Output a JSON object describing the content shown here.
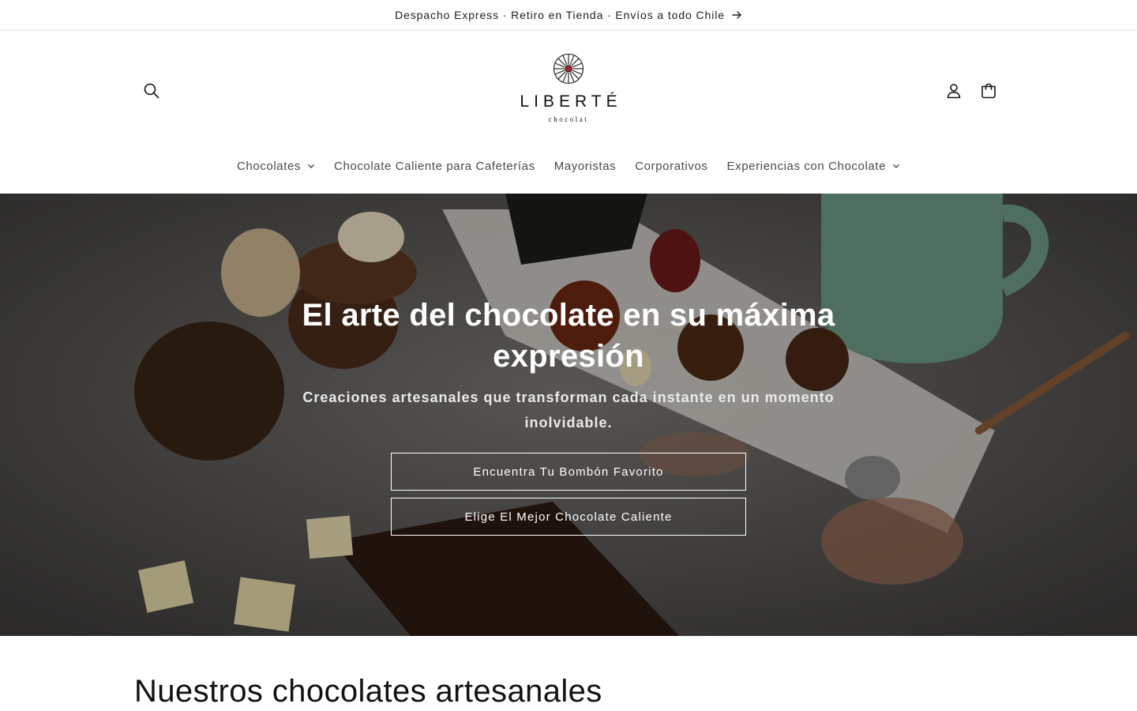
{
  "announcement": {
    "text": "Despacho Express · Retiro en Tienda · Envíos a todo Chile",
    "icon": "arrow-right-icon"
  },
  "header": {
    "search_icon": "search-icon",
    "account_icon": "account-icon",
    "cart_icon": "cart-icon",
    "logo": {
      "wordmark": "LIBERTÉ",
      "subtitle": "chocolat"
    }
  },
  "nav": {
    "items": [
      {
        "label": "Chocolates",
        "has_dropdown": true
      },
      {
        "label": "Chocolate Caliente para Cafeterías",
        "has_dropdown": false
      },
      {
        "label": "Mayoristas",
        "has_dropdown": false
      },
      {
        "label": "Corporativos",
        "has_dropdown": false
      },
      {
        "label": "Experiencias con Chocolate",
        "has_dropdown": true
      }
    ]
  },
  "hero": {
    "title": "El arte del chocolate en su máxima expresión",
    "subtitle": "Creaciones artesanales que transforman cada instante en un momento inolvidable.",
    "buttons": [
      {
        "label": "Encuentra Tu Bombón Favorito"
      },
      {
        "label": "Elige El Mejor Chocolate Caliente"
      }
    ]
  },
  "section": {
    "title": "Nuestros chocolates artesanales"
  },
  "colors": {
    "accent": "#b31b2b",
    "text": "#121212",
    "hero_overlay": "#000000"
  }
}
